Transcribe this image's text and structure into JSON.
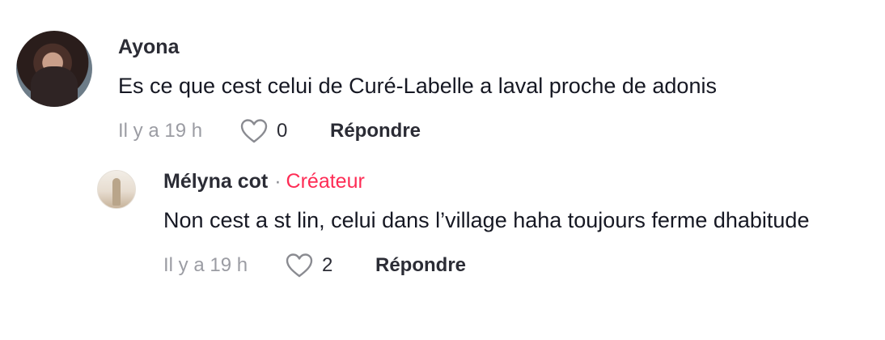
{
  "comments": [
    {
      "author": "Ayona",
      "text": "Es ce que cest celui de Curé-Labelle a laval proche de adonis",
      "time": "Il y a 19 h",
      "likes": "0",
      "reply_label": "Répondre"
    }
  ],
  "reply": {
    "author": "Mélyna cot",
    "separator": "·",
    "badge": "Créateur",
    "text": "Non cest a st lin, celui dans l’village haha toujours ferme dhabitude",
    "time": "Il y a 19 h",
    "likes": "2",
    "reply_label": "Répondre"
  },
  "icons": {
    "like": "heart-outline-icon"
  },
  "colors": {
    "creator_badge": "#fe2c55",
    "muted_text": "#9b9ca3",
    "primary_text": "#161823"
  }
}
